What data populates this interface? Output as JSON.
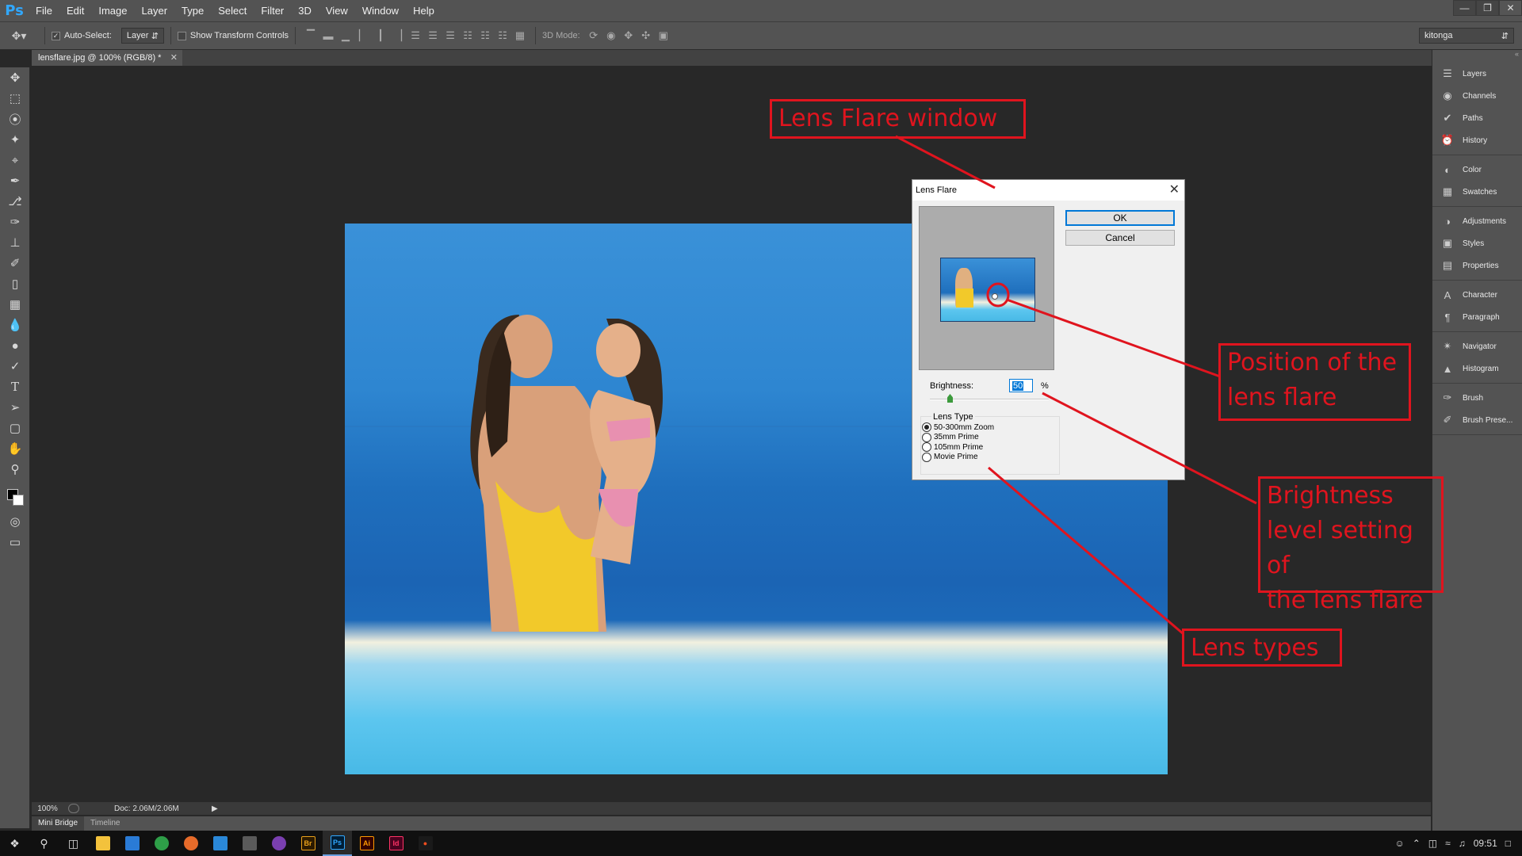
{
  "app": {
    "logo": "Ps",
    "workspace": "kitonga"
  },
  "menu": [
    "File",
    "Edit",
    "Image",
    "Layer",
    "Type",
    "Select",
    "Filter",
    "3D",
    "View",
    "Window",
    "Help"
  ],
  "options": {
    "auto_select_label": "Auto-Select:",
    "auto_select_checked": true,
    "auto_select_target": "Layer",
    "show_transform_label": "Show Transform Controls",
    "mode_3d_label": "3D Mode:"
  },
  "document": {
    "tab_title": "lensflare.jpg @ 100% (RGB/8) *"
  },
  "status": {
    "zoom": "100%",
    "doc_size": "Doc: 2.06M/2.06M"
  },
  "bottom_tabs": [
    "Mini Bridge",
    "Timeline"
  ],
  "panels": [
    [
      "Layers",
      "Channels",
      "Paths",
      "History"
    ],
    [
      "Color",
      "Swatches"
    ],
    [
      "Adjustments",
      "Styles",
      "Properties"
    ],
    [
      "Character",
      "Paragraph"
    ],
    [
      "Navigator",
      "Histogram"
    ],
    [
      "Brush",
      "Brush Prese..."
    ]
  ],
  "panel_icons": [
    [
      "layers-icon",
      "channels-icon",
      "paths-icon",
      "history-icon"
    ],
    [
      "color-icon",
      "swatches-icon"
    ],
    [
      "adjustments-icon",
      "styles-icon",
      "properties-icon"
    ],
    [
      "character-icon",
      "paragraph-icon"
    ],
    [
      "navigator-icon",
      "histogram-icon"
    ],
    [
      "brush-icon",
      "brush-presets-icon"
    ]
  ],
  "dialog": {
    "title": "Lens Flare",
    "ok_label": "OK",
    "cancel_label": "Cancel",
    "brightness_label": "Brightness:",
    "brightness_value": "50",
    "brightness_unit": "%",
    "brightness_fraction": 0.17,
    "lens_type_label": "Lens Type",
    "lens_types": [
      "50-300mm Zoom",
      "35mm Prime",
      "105mm Prime",
      "Movie Prime"
    ],
    "selected_lens": 0
  },
  "annotations": {
    "window": "Lens Flare window",
    "position": [
      "Position of the",
      "lens flare"
    ],
    "brightness": [
      "Brightness",
      "level setting of",
      "the lens flare"
    ],
    "lens_types": "Lens types",
    "color": "#e0141e"
  },
  "taskbar": {
    "time": "09:51"
  }
}
